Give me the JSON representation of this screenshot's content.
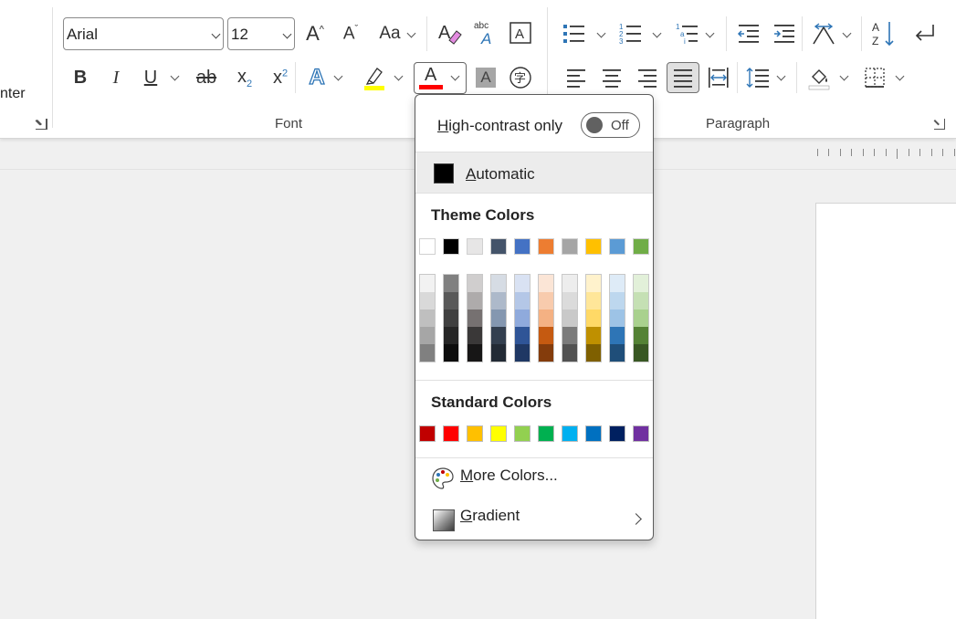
{
  "ribbon": {
    "clipboard_partial_label": "nter",
    "font_group": {
      "label": "Font",
      "font_name": "Arial",
      "font_size": "12",
      "grow_icon": "A^",
      "shrink_icon": "A˅",
      "change_case": "Aa",
      "bold": "B",
      "italic": "I",
      "underline": "U",
      "strikethrough": "ab",
      "subscript": "x",
      "subscript_sub": "2",
      "superscript": "x",
      "superscript_sup": "2",
      "text_effects": "A",
      "font_color": "A",
      "shading": "A",
      "phonetic": "abc",
      "phonetic_a": "A",
      "char_border": "A",
      "colors": {
        "highlight": "#ffff00",
        "font_color": "#ff0000",
        "text_effects": "#2e75b6"
      }
    },
    "paragraph_group": {
      "label": "Paragraph"
    }
  },
  "font_color_menu": {
    "high_contrast": {
      "label_prefix": "H",
      "label_rest": "igh-contrast only",
      "toggle_state": "Off"
    },
    "automatic": {
      "label_prefix": "A",
      "label_rest": "utomatic",
      "color": "#000000"
    },
    "theme_colors": {
      "title": "Theme Colors",
      "base": [
        "#ffffff",
        "#000000",
        "#e7e6e6",
        "#44546a",
        "#4472c4",
        "#ed7d31",
        "#a5a5a5",
        "#ffc000",
        "#5b9bd5",
        "#70ad47"
      ],
      "shades": [
        [
          "#f2f2f2",
          "#d9d9d9",
          "#bfbfbf",
          "#a6a6a6",
          "#808080"
        ],
        [
          "#808080",
          "#595959",
          "#404040",
          "#262626",
          "#0d0d0d"
        ],
        [
          "#d0cece",
          "#aeabab",
          "#767171",
          "#3a3838",
          "#171616"
        ],
        [
          "#d6dce4",
          "#adb9ca",
          "#8497b0",
          "#333f4f",
          "#222a35"
        ],
        [
          "#d9e2f3",
          "#b4c7e7",
          "#8faadc",
          "#2f5597",
          "#1f3864"
        ],
        [
          "#fbe5d6",
          "#f8cbad",
          "#f4b183",
          "#c55a11",
          "#843c0c"
        ],
        [
          "#ededed",
          "#dbdbdb",
          "#c9c9c9",
          "#7b7b7b",
          "#525252"
        ],
        [
          "#fff2cc",
          "#ffe699",
          "#ffd966",
          "#bf9000",
          "#7f6000"
        ],
        [
          "#deebf7",
          "#bdd7ee",
          "#9dc3e6",
          "#2e75b6",
          "#1f4e79"
        ],
        [
          "#e2f0d9",
          "#c5e0b4",
          "#a9d18e",
          "#548235",
          "#385723"
        ]
      ]
    },
    "standard_colors": {
      "title": "Standard Colors",
      "colors": [
        "#c00000",
        "#ff0000",
        "#ffc000",
        "#ffff00",
        "#92d050",
        "#00b050",
        "#00b0f0",
        "#0070c0",
        "#002060",
        "#7030a0"
      ]
    },
    "more_colors": {
      "label_prefix": "M",
      "label_rest": "ore Colors..."
    },
    "gradient": {
      "label_prefix": "G",
      "label_rest": "radient"
    }
  }
}
